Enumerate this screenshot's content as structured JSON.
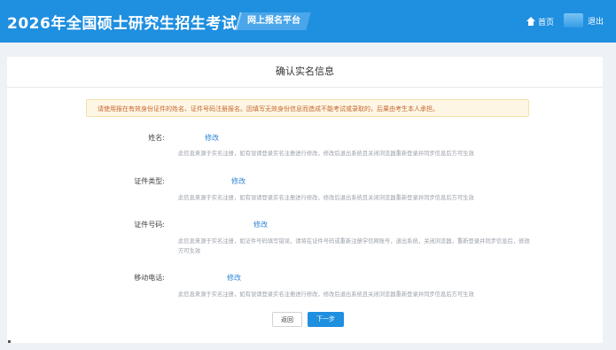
{
  "header": {
    "app_title": "2026年全国硕士研究生招生考试",
    "platform_tag": "网上报名平台",
    "home_label": "首页",
    "logout_label": "退出"
  },
  "page": {
    "title": "确认实名信息",
    "notice": "请使用报在有效身份证件的姓名、证件号码注册报名。因填写无效身份信息而造成不能考试或录取的，后果由考生本人承担。"
  },
  "fields": [
    {
      "label": "姓名:",
      "edit_label": "修改",
      "note": "此信息来源于实名注册，如有误请登录实名注册进行修改，修改后退出系统且关闭浏览器重新登录并同步信息后方可生效"
    },
    {
      "label": "证件类型:",
      "edit_label": "修改",
      "note": "此信息来源于实名注册，如有误请登录实名注册进行修改，修改后退出系统且关闭浏览器重新登录并同步信息后方可生效"
    },
    {
      "label": "证件号码:",
      "edit_label": "修改",
      "note": "此信息来源于实名注册，如证件号码填写错误，请将在证件号码或重新注册学信网账号，退出系统，关闭浏览器，重新登录并同步信息后，修改方可生效"
    },
    {
      "label": "移动电话:",
      "edit_label": "修改",
      "note": "此信息来源于实名注册，如有误请登录实名注册进行修改，修改后退出系统且关闭浏览器重新登录并同步信息后方可生效"
    }
  ],
  "actions": {
    "back_label": "返回",
    "next_label": "下一步"
  },
  "colors": {
    "header_bg": "#1f8fe0",
    "link": "#2f86d6",
    "notice_text": "#c8672f",
    "notice_bg": "#fdf6e4"
  },
  "icons": [
    "home-icon"
  ]
}
